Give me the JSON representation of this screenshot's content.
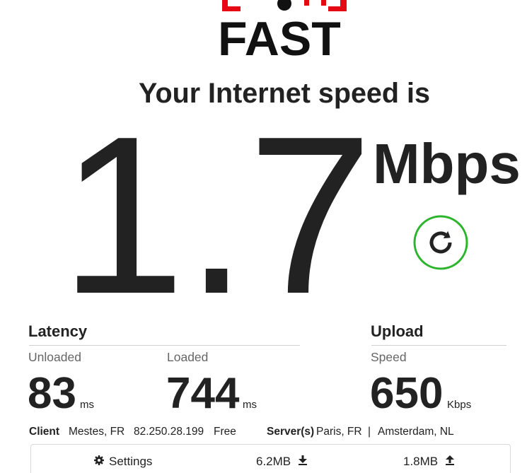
{
  "logo": {
    "text": "FAST",
    "accent_color": "#e50914",
    "icon": "fast-logo-mark-icon"
  },
  "headline": "Your Internet speed is",
  "speed": {
    "value": "1.7",
    "unit": "Mbps"
  },
  "refresh": {
    "icon": "refresh-icon",
    "ring_color": "#2cb52c"
  },
  "latency": {
    "title": "Latency",
    "unloaded": {
      "label": "Unloaded",
      "value": "83",
      "unit": "ms"
    },
    "loaded": {
      "label": "Loaded",
      "value": "744",
      "unit": "ms"
    }
  },
  "upload": {
    "title": "Upload",
    "speed": {
      "label": "Speed",
      "value": "650",
      "unit": "Kbps"
    }
  },
  "client": {
    "label": "Client",
    "location": "Mestes, FR",
    "ip": "82.250.28.199",
    "isp": "Free"
  },
  "servers": {
    "label": "Server(s)",
    "items": [
      "Paris, FR",
      "Amsterdam, NL"
    ],
    "separator": "|"
  },
  "footer": {
    "settings": {
      "icon": "gear-icon",
      "label": "Settings"
    },
    "downloaded": {
      "value": "6.2MB",
      "icon": "download-arrow-icon"
    },
    "uploaded": {
      "value": "1.8MB",
      "icon": "upload-arrow-icon"
    }
  }
}
